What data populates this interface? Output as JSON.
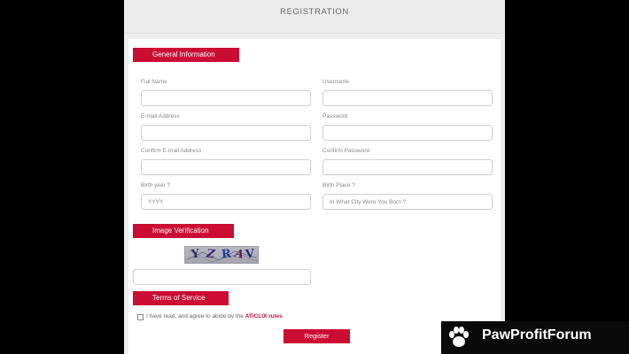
{
  "header": {
    "title": "REGISTRATION"
  },
  "sections": {
    "general": "General Information",
    "verification": "Image Verification",
    "terms": "Terms of Service"
  },
  "fields": {
    "full_name": {
      "label": "Full Name",
      "value": ""
    },
    "username": {
      "label": "Username",
      "value": ""
    },
    "email": {
      "label": "E-mail Address",
      "value": ""
    },
    "password": {
      "label": "Password",
      "value": ""
    },
    "confirm_email": {
      "label": "Confirm E-mail Address",
      "value": ""
    },
    "confirm_password": {
      "label": "Confirm Password",
      "value": ""
    },
    "birth_year": {
      "label": "Birth year ?",
      "placeholder": "YYYY"
    },
    "birth_place": {
      "label": "Birth Place ?",
      "placeholder": "In What City Were You Born ?"
    },
    "captcha_answer": {
      "value": ""
    }
  },
  "captcha": {
    "chars": [
      "Y",
      "Z",
      "R",
      "A",
      "V"
    ],
    "colors": [
      "#2b2a6b",
      "#3a1f6e",
      "#1f3a8c",
      "#5a1f5a",
      "#1f2a7a"
    ]
  },
  "terms": {
    "text": "I have read, and agree to abide by the",
    "link": "ATiCLIX rules",
    "checked": false
  },
  "register_label": "Register",
  "watermark": {
    "text": "PawProfitForum",
    "icon": "paw-icon"
  },
  "colors": {
    "accent": "#cc0d33",
    "panel": "#ededed"
  }
}
